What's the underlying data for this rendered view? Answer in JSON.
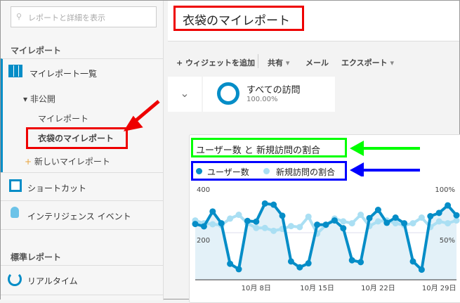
{
  "sidebar": {
    "search_placeholder": "レポートと詳細を表示",
    "section_my": "マイレポート",
    "my_reports_list": "マイレポート一覧",
    "private": "非公開",
    "my_report": "マイレポート",
    "selected_report": "衣袋のマイレポート",
    "new_report": "新しいマイレポート",
    "shortcut": "ショートカット",
    "intelligence": "インテリジェンス イベント",
    "section_standard": "標準レポート",
    "realtime": "リアルタイム"
  },
  "header": {
    "title": "衣袋のマイレポート"
  },
  "toolbar": {
    "add_widget": "+ ウィジェットを追加",
    "share": "共有",
    "email": "メール",
    "export": "エクスポート"
  },
  "segment": {
    "name": "すべての訪問",
    "percent": "100.00%"
  },
  "widget": {
    "title": "ユーザー数 と 新規訪問の割合"
  },
  "chart_data": {
    "type": "line",
    "title": "ユーザー数 と 新規訪問の割合",
    "legend": [
      "ユーザー数",
      "新規訪問の割合"
    ],
    "x": [
      1,
      2,
      3,
      4,
      5,
      6,
      7,
      8,
      9,
      10,
      11,
      12,
      13,
      14,
      15,
      16,
      17,
      18,
      19,
      20,
      21,
      22,
      23,
      24,
      25,
      26,
      27,
      28,
      29,
      30,
      31
    ],
    "xtick_labels": [
      {
        "day": 8,
        "label": "10月 8日"
      },
      {
        "day": 15,
        "label": "10月 15日"
      },
      {
        "day": 22,
        "label": "10月 22日"
      },
      {
        "day": 29,
        "label": "10月 29日"
      }
    ],
    "left_ticks": [
      "400",
      "200"
    ],
    "right_ticks": [
      "100%",
      "50%"
    ],
    "ylim_left": [
      0,
      400
    ],
    "ylim_right": [
      0,
      100
    ],
    "series": [
      {
        "name": "ユーザー数",
        "axis": "left",
        "color": "#058dc7",
        "values": [
          237,
          227,
          290,
          240,
          68,
          45,
          250,
          247,
          324,
          319,
          272,
          78,
          53,
          70,
          234,
          234,
          252,
          219,
          83,
          75,
          262,
          297,
          242,
          264,
          240,
          78,
          43,
          270,
          284,
          316,
          274
        ]
      },
      {
        "name": "新規訪問の割合",
        "axis": "right",
        "color": "#aadff3",
        "values": [
          63,
          60,
          59,
          58,
          65,
          69,
          60,
          55,
          55,
          52,
          54,
          57,
          56,
          67,
          49,
          58,
          65,
          62,
          60,
          69,
          57,
          62,
          63,
          60,
          58,
          60,
          66,
          56,
          62,
          60,
          63
        ]
      }
    ]
  }
}
